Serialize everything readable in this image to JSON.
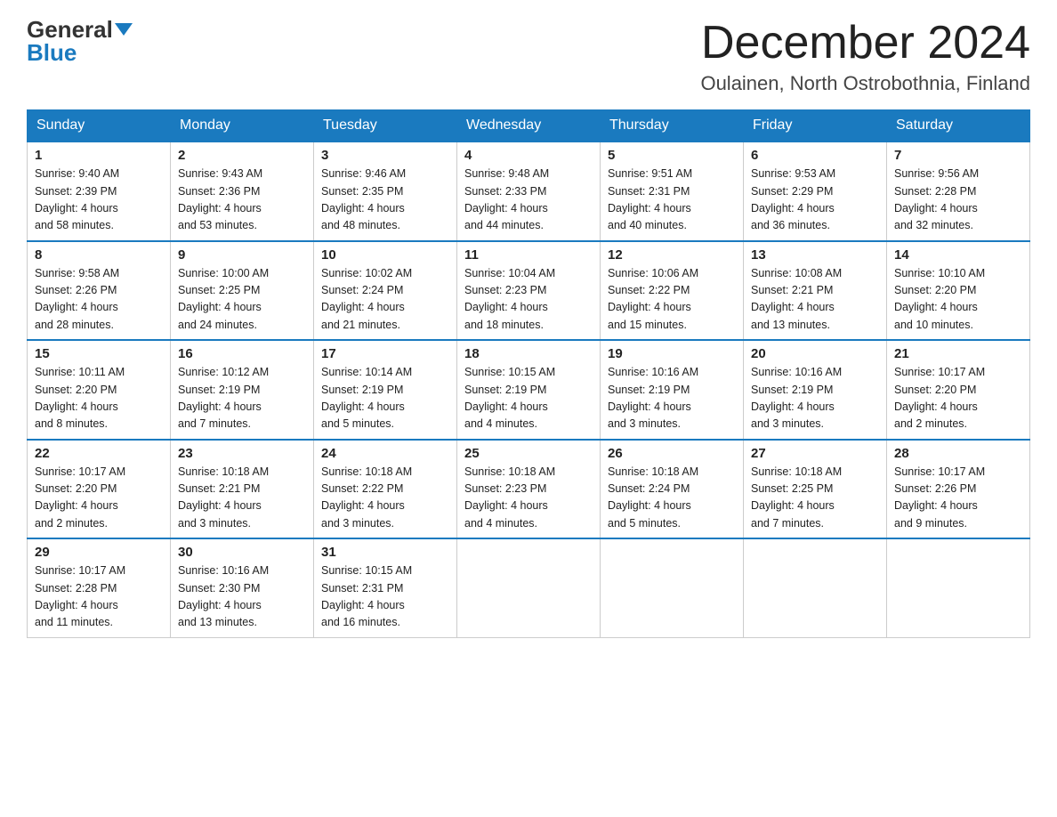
{
  "logo": {
    "general": "General",
    "blue": "Blue"
  },
  "title": "December 2024",
  "location": "Oulainen, North Ostrobothnia, Finland",
  "weekdays": [
    "Sunday",
    "Monday",
    "Tuesday",
    "Wednesday",
    "Thursday",
    "Friday",
    "Saturday"
  ],
  "weeks": [
    [
      {
        "day": "1",
        "sunrise": "9:40 AM",
        "sunset": "2:39 PM",
        "daylight": "4 hours and 58 minutes."
      },
      {
        "day": "2",
        "sunrise": "9:43 AM",
        "sunset": "2:36 PM",
        "daylight": "4 hours and 53 minutes."
      },
      {
        "day": "3",
        "sunrise": "9:46 AM",
        "sunset": "2:35 PM",
        "daylight": "4 hours and 48 minutes."
      },
      {
        "day": "4",
        "sunrise": "9:48 AM",
        "sunset": "2:33 PM",
        "daylight": "4 hours and 44 minutes."
      },
      {
        "day": "5",
        "sunrise": "9:51 AM",
        "sunset": "2:31 PM",
        "daylight": "4 hours and 40 minutes."
      },
      {
        "day": "6",
        "sunrise": "9:53 AM",
        "sunset": "2:29 PM",
        "daylight": "4 hours and 36 minutes."
      },
      {
        "day": "7",
        "sunrise": "9:56 AM",
        "sunset": "2:28 PM",
        "daylight": "4 hours and 32 minutes."
      }
    ],
    [
      {
        "day": "8",
        "sunrise": "9:58 AM",
        "sunset": "2:26 PM",
        "daylight": "4 hours and 28 minutes."
      },
      {
        "day": "9",
        "sunrise": "10:00 AM",
        "sunset": "2:25 PM",
        "daylight": "4 hours and 24 minutes."
      },
      {
        "day": "10",
        "sunrise": "10:02 AM",
        "sunset": "2:24 PM",
        "daylight": "4 hours and 21 minutes."
      },
      {
        "day": "11",
        "sunrise": "10:04 AM",
        "sunset": "2:23 PM",
        "daylight": "4 hours and 18 minutes."
      },
      {
        "day": "12",
        "sunrise": "10:06 AM",
        "sunset": "2:22 PM",
        "daylight": "4 hours and 15 minutes."
      },
      {
        "day": "13",
        "sunrise": "10:08 AM",
        "sunset": "2:21 PM",
        "daylight": "4 hours and 13 minutes."
      },
      {
        "day": "14",
        "sunrise": "10:10 AM",
        "sunset": "2:20 PM",
        "daylight": "4 hours and 10 minutes."
      }
    ],
    [
      {
        "day": "15",
        "sunrise": "10:11 AM",
        "sunset": "2:20 PM",
        "daylight": "4 hours and 8 minutes."
      },
      {
        "day": "16",
        "sunrise": "10:12 AM",
        "sunset": "2:19 PM",
        "daylight": "4 hours and 7 minutes."
      },
      {
        "day": "17",
        "sunrise": "10:14 AM",
        "sunset": "2:19 PM",
        "daylight": "4 hours and 5 minutes."
      },
      {
        "day": "18",
        "sunrise": "10:15 AM",
        "sunset": "2:19 PM",
        "daylight": "4 hours and 4 minutes."
      },
      {
        "day": "19",
        "sunrise": "10:16 AM",
        "sunset": "2:19 PM",
        "daylight": "4 hours and 3 minutes."
      },
      {
        "day": "20",
        "sunrise": "10:16 AM",
        "sunset": "2:19 PM",
        "daylight": "4 hours and 3 minutes."
      },
      {
        "day": "21",
        "sunrise": "10:17 AM",
        "sunset": "2:20 PM",
        "daylight": "4 hours and 2 minutes."
      }
    ],
    [
      {
        "day": "22",
        "sunrise": "10:17 AM",
        "sunset": "2:20 PM",
        "daylight": "4 hours and 2 minutes."
      },
      {
        "day": "23",
        "sunrise": "10:18 AM",
        "sunset": "2:21 PM",
        "daylight": "4 hours and 3 minutes."
      },
      {
        "day": "24",
        "sunrise": "10:18 AM",
        "sunset": "2:22 PM",
        "daylight": "4 hours and 3 minutes."
      },
      {
        "day": "25",
        "sunrise": "10:18 AM",
        "sunset": "2:23 PM",
        "daylight": "4 hours and 4 minutes."
      },
      {
        "day": "26",
        "sunrise": "10:18 AM",
        "sunset": "2:24 PM",
        "daylight": "4 hours and 5 minutes."
      },
      {
        "day": "27",
        "sunrise": "10:18 AM",
        "sunset": "2:25 PM",
        "daylight": "4 hours and 7 minutes."
      },
      {
        "day": "28",
        "sunrise": "10:17 AM",
        "sunset": "2:26 PM",
        "daylight": "4 hours and 9 minutes."
      }
    ],
    [
      {
        "day": "29",
        "sunrise": "10:17 AM",
        "sunset": "2:28 PM",
        "daylight": "4 hours and 11 minutes."
      },
      {
        "day": "30",
        "sunrise": "10:16 AM",
        "sunset": "2:30 PM",
        "daylight": "4 hours and 13 minutes."
      },
      {
        "day": "31",
        "sunrise": "10:15 AM",
        "sunset": "2:31 PM",
        "daylight": "4 hours and 16 minutes."
      },
      null,
      null,
      null,
      null
    ]
  ],
  "labels": {
    "sunrise": "Sunrise:",
    "sunset": "Sunset:",
    "daylight": "Daylight:"
  }
}
